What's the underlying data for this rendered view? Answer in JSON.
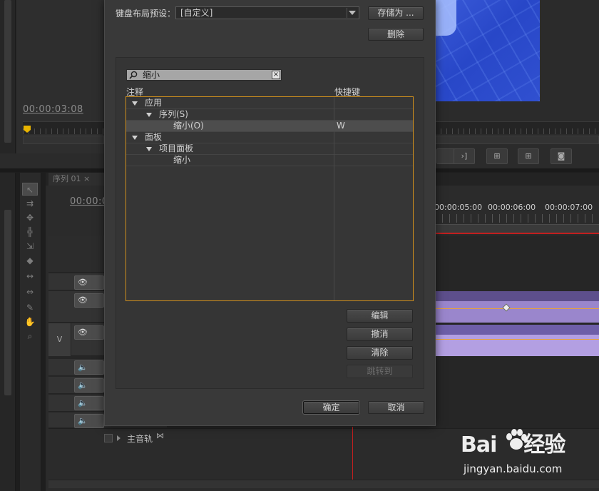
{
  "background": {
    "source_timecode": "00:00:03:08",
    "sequence_tab": "序列 01 ×",
    "timeline_timecode": "00:00:0",
    "ruler_labels": [
      "00:00:05:00",
      "00:00:06:00",
      "00:00:07:00"
    ],
    "track_v_label": "V",
    "master_track_label": "主音轨"
  },
  "dialog": {
    "preset_label": "键盘布局预设：",
    "preset_value": "[自定义]",
    "save_as_label": "存储为 ...",
    "delete_label": "删除",
    "search_value": "缩小",
    "search_clear": "×",
    "column_note": "注释",
    "column_shortcut": "快捷键",
    "tree": [
      {
        "label": "应用",
        "shortcut": "",
        "level": 0,
        "expanded": true
      },
      {
        "label": "序列(S)",
        "shortcut": "",
        "level": 1,
        "expanded": true
      },
      {
        "label": "缩小(O)",
        "shortcut": "W",
        "level": 2,
        "selected": true
      },
      {
        "label": "面板",
        "shortcut": "",
        "level": 0,
        "expanded": true
      },
      {
        "label": "项目面板",
        "shortcut": "",
        "level": 1,
        "expanded": true
      },
      {
        "label": "缩小",
        "shortcut": "",
        "level": 2
      }
    ],
    "edit_label": "编辑",
    "undo_label": "撤消",
    "clear_label": "清除",
    "goto_label": "跳转到",
    "ok_label": "确定",
    "cancel_label": "取消"
  },
  "watermark": {
    "brand_left": "Bai",
    "brand_right": "经验",
    "url": "jingyan.baidu.com"
  },
  "colors": {
    "dialog_bg": "#393939",
    "focus_border": "#cf8f1d",
    "playhead": "#c21f1f",
    "clip_purple": "#b39fe2"
  }
}
